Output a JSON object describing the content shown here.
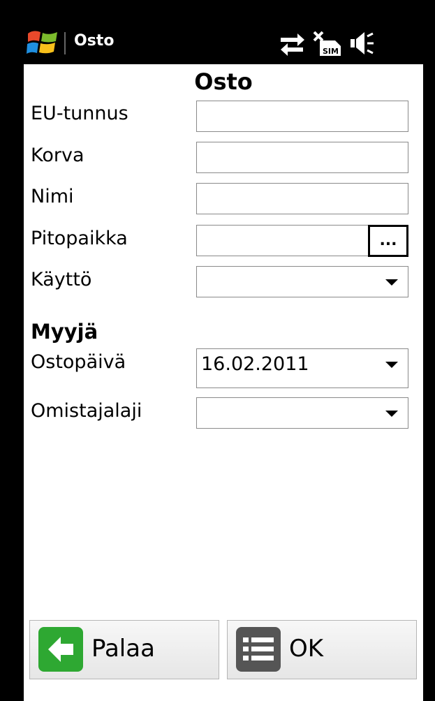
{
  "titlebar": {
    "title": "Osto"
  },
  "form": {
    "heading": "Osto",
    "fields": [
      {
        "label": "EU-tunnus",
        "value": ""
      },
      {
        "label": "Korva",
        "value": ""
      },
      {
        "label": "Nimi",
        "value": ""
      },
      {
        "label": "Pitopaikka",
        "value": "",
        "browse_label": "..."
      },
      {
        "label": "Käyttö",
        "value": ""
      }
    ],
    "section": "Myyjä",
    "seller_fields": [
      {
        "label": "Ostopäivä",
        "value": "16.02.2011"
      },
      {
        "label": "Omistajalaji",
        "value": ""
      }
    ]
  },
  "buttons": {
    "back": "Palaa",
    "ok": "OK"
  },
  "colors": {
    "back_icon": "#2ea832",
    "ok_icon": "#555555",
    "titlebar": "#000000"
  },
  "icons": [
    "windows-logo-icon",
    "connectivity-icon",
    "no-sim-icon",
    "speaker-icon"
  ]
}
